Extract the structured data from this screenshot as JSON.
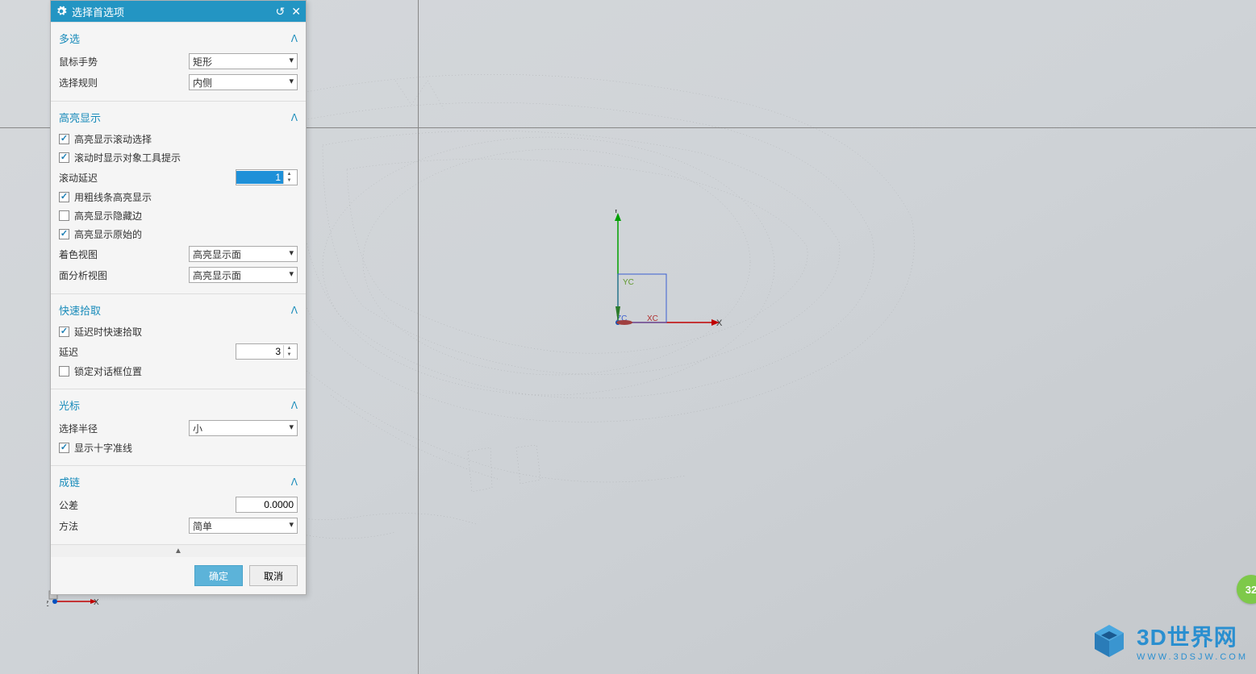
{
  "dialog": {
    "title": "选择首选项",
    "sections": {
      "multi": {
        "title": "多选",
        "mouse_gesture_label": "鼠标手势",
        "mouse_gesture_value": "矩形",
        "select_rule_label": "选择规则",
        "select_rule_value": "内侧"
      },
      "highlight": {
        "title": "高亮显示",
        "cb_roll_highlight": "高亮显示滚动选择",
        "cb_roll_tooltip": "滚动时显示对象工具提示",
        "roll_delay_label": "滚动延迟",
        "roll_delay_value": "1",
        "cb_thick_lines": "用粗线条高亮显示",
        "cb_hidden_edges": "高亮显示隐藏边",
        "cb_original": "高亮显示原始的",
        "shaded_view_label": "着色视图",
        "shaded_view_value": "高亮显示面",
        "analysis_view_label": "面分析视图",
        "analysis_view_value": "高亮显示面"
      },
      "quickpick": {
        "title": "快速拾取",
        "cb_delay_quickpick": "延迟时快速拾取",
        "delay_label": "延迟",
        "delay_value": "3",
        "cb_lock_dialog": "锁定对话框位置"
      },
      "cursor": {
        "title": "光标",
        "select_radius_label": "选择半径",
        "select_radius_value": "小",
        "cb_crosshair": "显示十字准线"
      },
      "chain": {
        "title": "成链",
        "tolerance_label": "公差",
        "tolerance_value": "0.0000",
        "method_label": "方法",
        "method_value": "简单"
      }
    },
    "buttons": {
      "ok": "确定",
      "cancel": "取消"
    }
  },
  "csys": {
    "x": "X",
    "y": "Y",
    "z": "Z",
    "xc": "XC",
    "yc": "YC",
    "zc": "ZC"
  },
  "watermark": {
    "title": "3D世界网",
    "url": "WWW.3DSJW.COM"
  },
  "badge": "32"
}
